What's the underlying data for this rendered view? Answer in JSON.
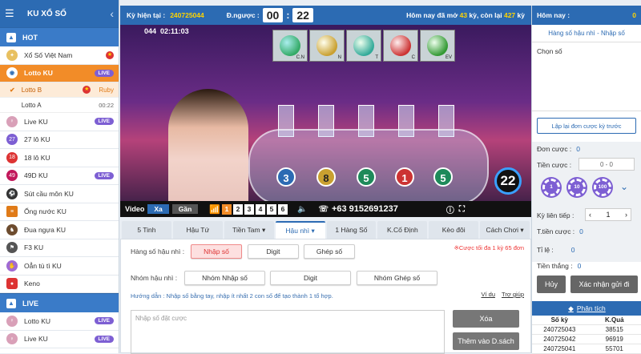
{
  "sidebar": {
    "title": "KU XỔ SỐ",
    "hot_label": "HOT",
    "items": [
      {
        "label": "Xổ Số Việt Nam",
        "badge": "flag"
      },
      {
        "label": "Lotto KU",
        "badge": "LIVE"
      },
      {
        "label": "Live KU",
        "badge": "LIVE"
      },
      {
        "label": "27 lô KU",
        "badge": ""
      },
      {
        "label": "18 lô KU",
        "badge": ""
      },
      {
        "label": "49D KU",
        "badge": "LIVE"
      },
      {
        "label": "Sút cầu môn KU",
        "badge": ""
      },
      {
        "label": "Ống nước KU",
        "badge": ""
      },
      {
        "label": "Đua ngựa KU",
        "badge": ""
      },
      {
        "label": "F3 KU",
        "badge": ""
      },
      {
        "label": "Oẳn tù tì KU",
        "badge": ""
      },
      {
        "label": "Keno",
        "badge": ""
      }
    ],
    "subitems": [
      {
        "label": "Lotto B",
        "right": "Ruby"
      },
      {
        "label": "Lotto A",
        "right": "00:22"
      }
    ],
    "live_label": "LIVE",
    "live_items": [
      {
        "label": "Lotto KU",
        "badge": "LIVE"
      },
      {
        "label": "Live KU",
        "badge": "LIVE"
      }
    ],
    "live_badge": "LIVE"
  },
  "topbar": {
    "ky_label": "Kỳ hiện tại :",
    "ky_value": "240725044",
    "dnguoc_label": "Đ.ngược :",
    "cd_min": "00",
    "cd_sec": "22",
    "today_pre": "Hôm nay đã mở",
    "today_open": "43",
    "today_mid": "kỳ, còn lại",
    "today_left": "427",
    "today_post": "kỳ"
  },
  "video": {
    "round": "044",
    "time": "02:11:03",
    "tube_labels": [
      "C.N",
      "N",
      "T",
      "C",
      "EV"
    ],
    "numbers": [
      "3",
      "8",
      "5",
      "1",
      "5"
    ],
    "big_number": "22",
    "label": "Video",
    "xa": "Xa",
    "gan": "Gần",
    "quality": [
      "1",
      "2",
      "3",
      "4",
      "5",
      "6"
    ],
    "phone": "+63 9152691237"
  },
  "tabs": [
    "5 Tinh",
    "Hậu Tứ",
    "Tiền Tam ▾",
    "Hậu nhì ▾",
    "1 Hàng Số",
    "K.Cố Định",
    "Kèo đôi",
    "Cách Chơi ▾"
  ],
  "panel": {
    "hang_label": "Hàng số hậu nhì :",
    "btn_nhap": "Nhập số",
    "btn_digit": "Digit",
    "btn_ghep": "Ghép số",
    "warn": "※Cược tối đa 1 kỳ 65 đơn",
    "nhom_label": "Nhóm hậu nhì :",
    "btn_nhom_nhap": "Nhóm Nhập số",
    "btn_nhom_digit": "Digit",
    "btn_nhom_ghep": "Nhóm Ghép số",
    "hint": "Hướng dẫn : Nhập số bằng tay, nhập ít nhất 2 con số để tạo thành 1 tổ hợp.",
    "vidu": "Ví dụ",
    "trogiup": "Trợ giúp",
    "placeholder": "Nhập số đặt cược",
    "xoa": "Xóa",
    "them": "Thêm vào D.sách"
  },
  "right": {
    "homnay": "Hôm nay :",
    "homnay_val": "0",
    "mode": "Hàng số hậu nhì - Nhập số",
    "chon": "Chọn số",
    "lap": "Lập lại đơn cược kỳ trước",
    "don_cuoc": "Đơn cược :",
    "don_val": "0",
    "tien_cuoc": "Tiền cược :",
    "tien_range": "0 - 0",
    "chips": [
      "1",
      "10",
      "100"
    ],
    "ky_lien": "Kỳ liên tiếp :",
    "ky_val": "1",
    "tcuoc": "T.tiền cược :",
    "tcuoc_val": "0",
    "tile": "Tỉ lệ :",
    "tile_val": "0",
    "tienthang": "Tiền thắng :",
    "tienthang_val": "0",
    "huy": "Hủy",
    "xacnhan": "Xác nhận gửi đi",
    "phantich": "Phân tích",
    "table_head": [
      "Số kỳ",
      "K.Quả"
    ],
    "table_rows": [
      [
        "240725043",
        "38515"
      ],
      [
        "240725042",
        "96919"
      ],
      [
        "240725041",
        "55701"
      ]
    ]
  }
}
